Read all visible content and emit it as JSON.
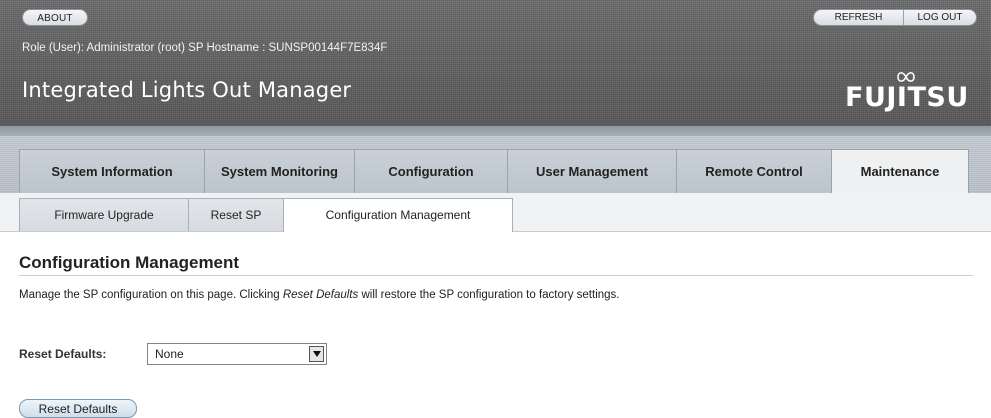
{
  "header": {
    "about_label": "ABOUT",
    "refresh_label": "REFRESH",
    "logout_label": "LOG OUT",
    "role_line": "Role (User): Administrator (root)   SP Hostname : SUNSP00144F7E834F",
    "app_title": "Integrated Lights Out Manager",
    "logo_text": "FUJITSU"
  },
  "main_tabs": [
    {
      "label": "System Information"
    },
    {
      "label": "System Monitoring"
    },
    {
      "label": "Configuration"
    },
    {
      "label": "User Management"
    },
    {
      "label": "Remote Control"
    },
    {
      "label": "Maintenance",
      "active": true
    }
  ],
  "sub_tabs": [
    {
      "label": "Firmware Upgrade"
    },
    {
      "label": "Reset SP"
    },
    {
      "label": "Configuration Management",
      "active": true
    }
  ],
  "content": {
    "title": "Configuration Management",
    "description_before": "Manage the SP configuration on this page. Clicking ",
    "description_em": "Reset Defaults",
    "description_after": " will restore the SP configuration to factory settings.",
    "reset_defaults_label": "Reset Defaults:",
    "reset_defaults_value": "None",
    "reset_button_label": "Reset Defaults"
  },
  "colors": {
    "masthead": "#5e5e5e",
    "tabbar": "#c0c7cf",
    "button_blue": "#cfdeea"
  }
}
